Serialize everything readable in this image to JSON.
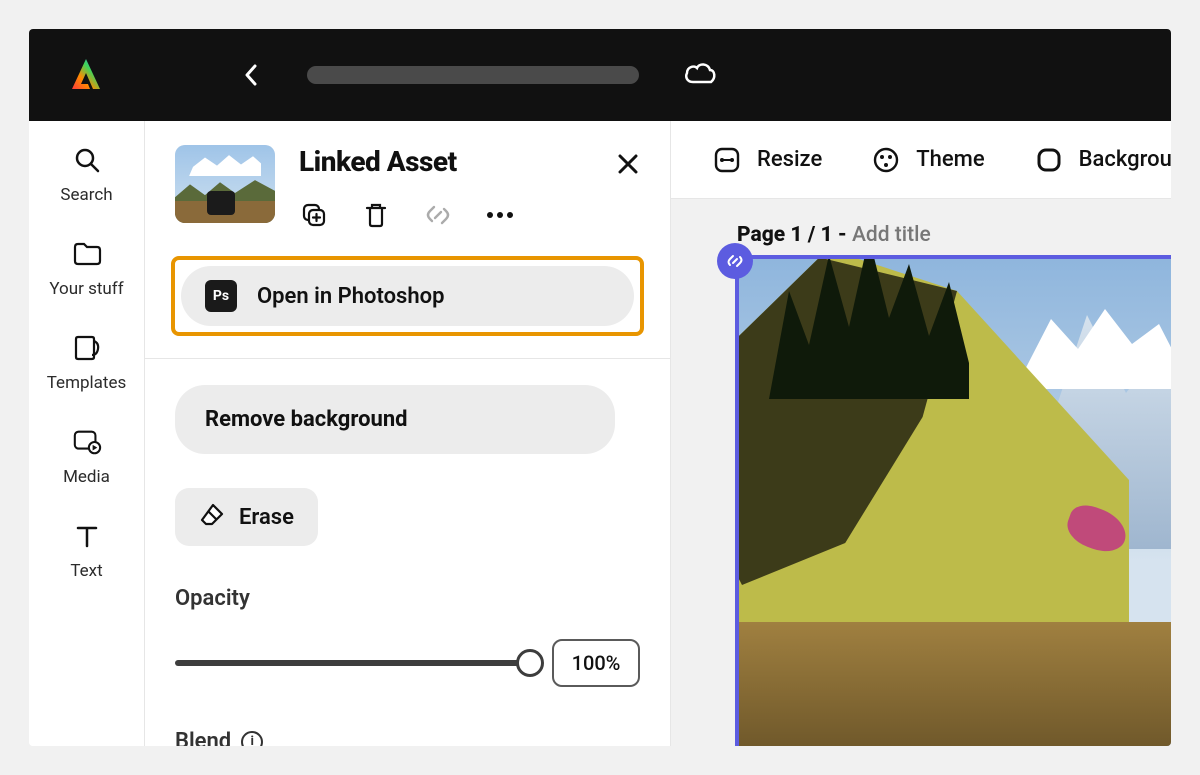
{
  "leftrail": {
    "search": "Search",
    "yourstuff": "Your stuff",
    "templates": "Templates",
    "media": "Media",
    "text": "Text"
  },
  "panel": {
    "title": "Linked Asset",
    "open_ps": "Open in Photoshop",
    "ps_badge": "Ps",
    "remove_bg": "Remove background",
    "erase": "Erase",
    "opacity_label": "Opacity",
    "opacity_value": "100%",
    "blend_label": "Blend"
  },
  "toolbar": {
    "resize": "Resize",
    "theme": "Theme",
    "background": "Background"
  },
  "page": {
    "prefix": "Page 1 / 1 - ",
    "placeholder": "Add title"
  }
}
